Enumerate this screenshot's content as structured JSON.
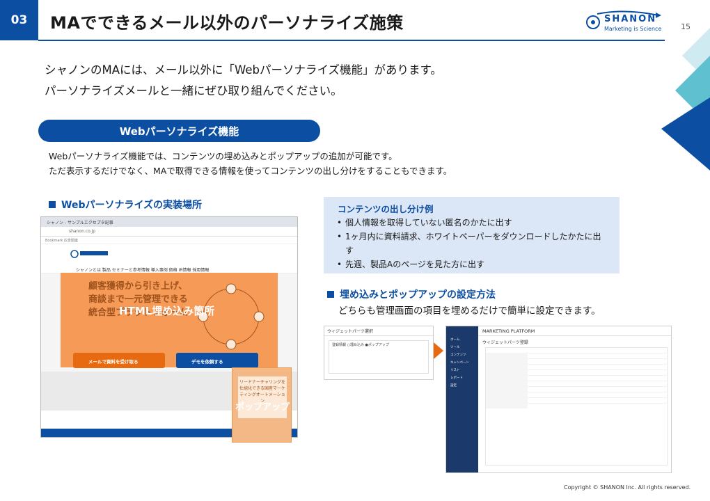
{
  "header": {
    "section_no": "03",
    "title": "MAでできるメール以外のパーソナライズ施策",
    "page_no": "15",
    "logo_text": "SHANON",
    "logo_sub": "Marketing is Science"
  },
  "intro": {
    "line1": "シャノンのMAには、メール以外に「Webパーソナライズ機能」があります。",
    "line2": "パーソナライズメールと一緒にぜひ取り組んでください。"
  },
  "pill": "Webパーソナライズ機能",
  "desc": {
    "line1": "Webパーソナライズ機能では、コンテンツの埋め込みとポップアップの追加が可能です。",
    "line2": "ただ表示するだけでなく、MAで取得できる情報を使ってコンテンツの出し分けをすることもできます。"
  },
  "impl": {
    "heading": "Webパーソナライズの実装場所",
    "browser_tab": "シャノン - サンプルエクセプタ記事",
    "browser_url": "shanon.co.jp",
    "bookmarks": "Bookmark    広告関連",
    "nav_menu": "シャノンとは    製品    セミナーと参考情報    導入事例    価格    IR情報    採用情報",
    "hero_text_1": "顧客獲得から引き上げ、",
    "hero_text_2": "商談まで一元管理できる",
    "hero_text_3": "統合型プラットフォーム",
    "embed_label": "HTML埋め込み箇所",
    "btn_docs": "メールで資料を受け取る",
    "btn_demo": "デモを依頼する",
    "popup_text": "リードナーチャリングを仕組化できる国産マーケティングオートメーション",
    "popup_label": "ポップアップ"
  },
  "content_example": {
    "title": "コンテンツの出し分け例",
    "items": [
      "個人情報を取得していない匿名のかたに出す",
      "1ヶ月内に資料請求、ホワイトペーパーをダウンロードしたかたに出す",
      "先週、製品Aのページを見た方に出す"
    ]
  },
  "setup": {
    "heading": "埋め込みとポップアップの設定方法",
    "desc": "どちらも管理画面の項目を埋めるだけで簡単に設定できます。",
    "s1_title": "ウィジェットパーツ選択",
    "s1_body": "登録情報  ○埋め込み ●ポップアップ",
    "s2_brand": "MARKETING PLATFORM",
    "s2_sub": "ウィジェットパーツ登録",
    "s2_menu": [
      "ホーム",
      "ツール",
      "コンテンツ",
      "キャンペーン",
      "リスト",
      "レポート",
      "設定"
    ]
  },
  "copyright": "Copyright © SHANON Inc. All rights reserved.",
  "colors": {
    "brand": "#0b4ea2",
    "accent": "#e86a10",
    "hero": "#f59a57",
    "panel": "#dbe7f6"
  }
}
